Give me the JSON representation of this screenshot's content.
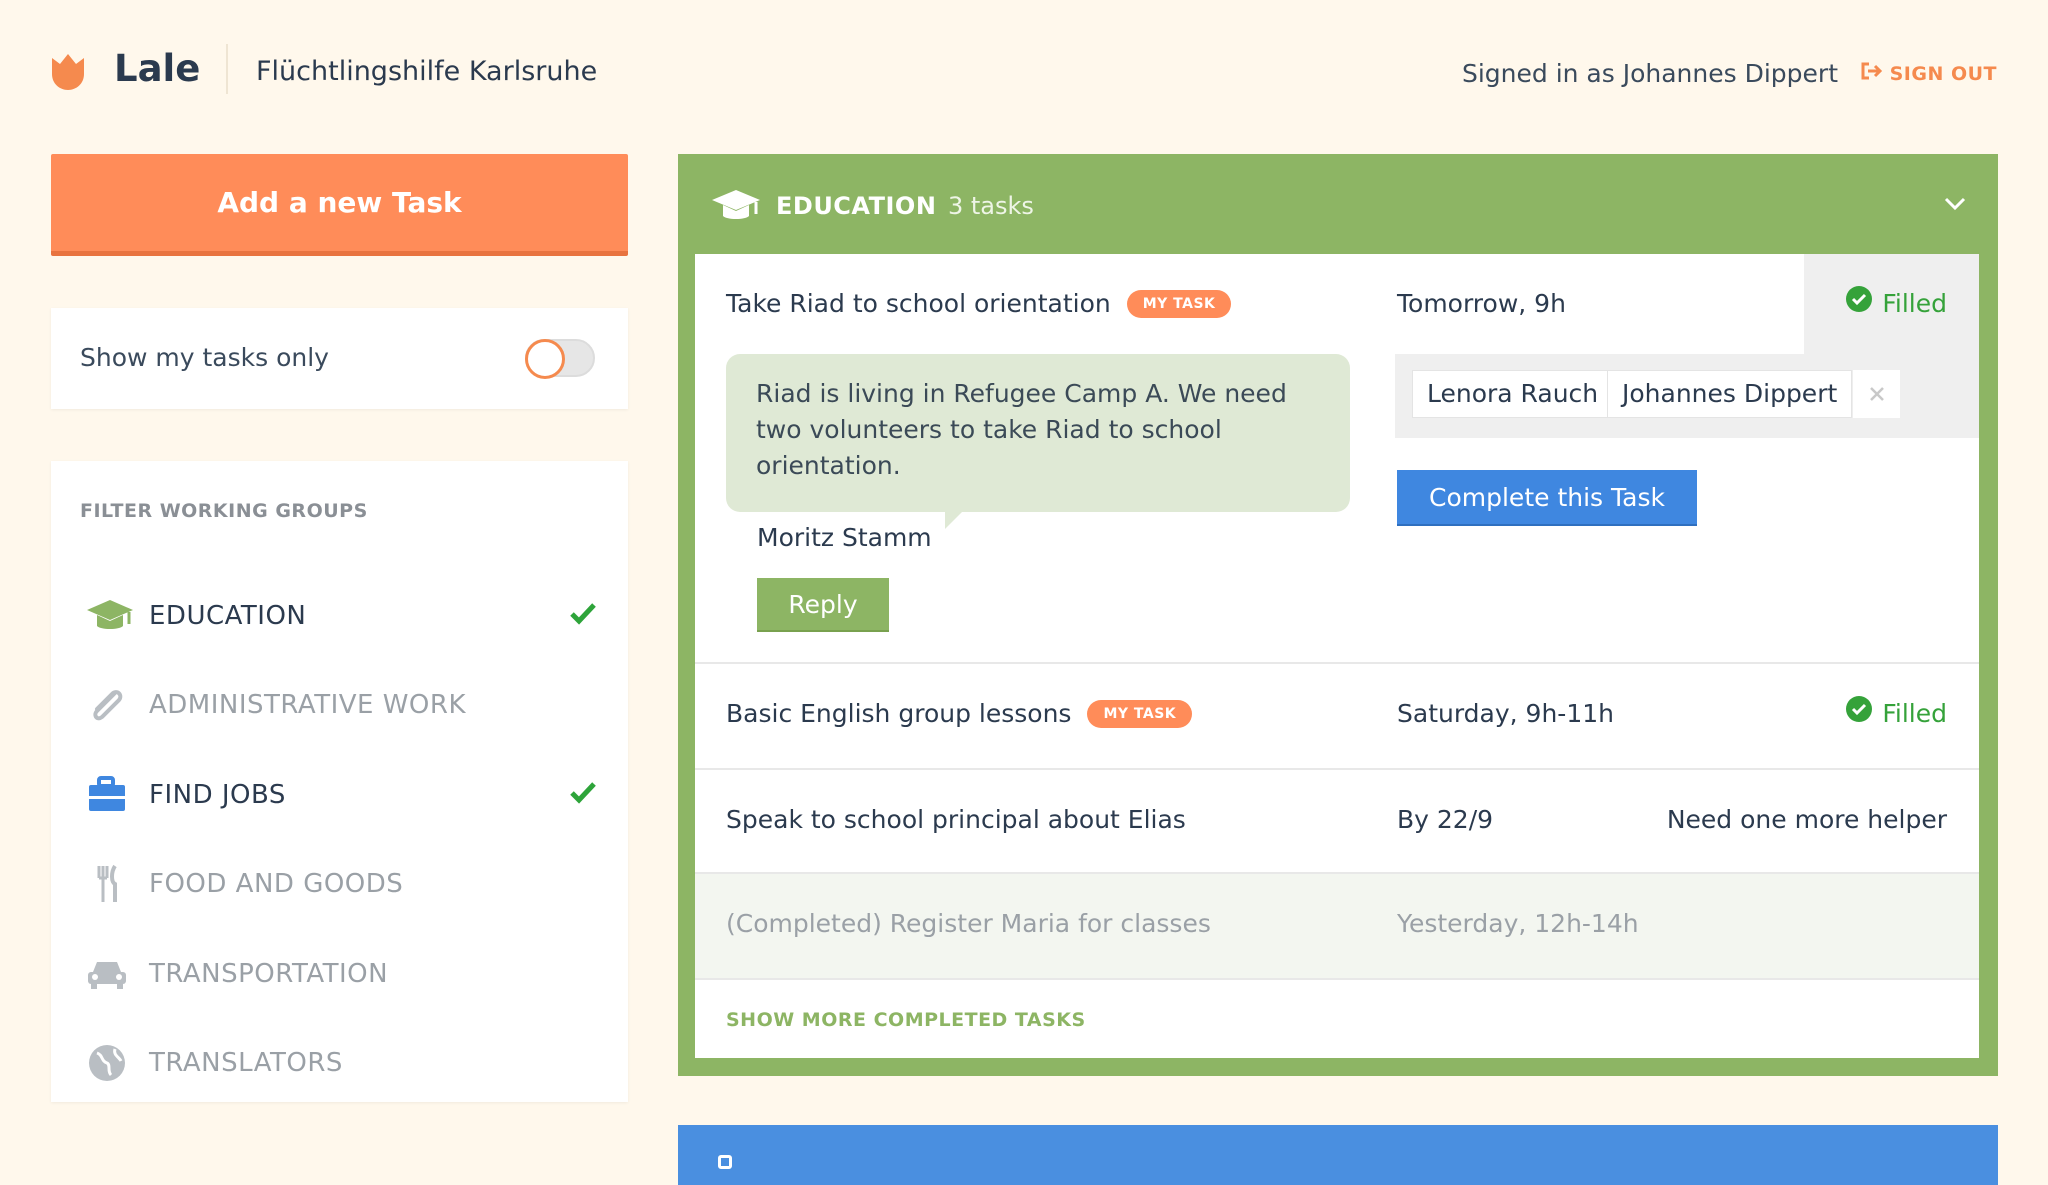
{
  "header": {
    "brand": "Lale",
    "organization": "Flüchtlingshilfe Karlsruhe",
    "signed_in": "Signed in as Johannes Dippert",
    "sign_out": "SIGN OUT"
  },
  "sidebar": {
    "add_task": "Add a new Task",
    "toggle_label": "Show my tasks only",
    "toggle_on": false,
    "filter_title": "FILTER WORKING GROUPS",
    "groups": [
      {
        "label": "EDUCATION",
        "icon": "graduation-cap-icon",
        "selected": true
      },
      {
        "label": "ADMINISTRATIVE WORK",
        "icon": "paperclip-icon",
        "selected": false
      },
      {
        "label": "FIND JOBS",
        "icon": "briefcase-icon",
        "selected": true
      },
      {
        "label": "FOOD AND GOODS",
        "icon": "fork-knife-icon",
        "selected": false
      },
      {
        "label": "TRANSPORTATION",
        "icon": "car-icon",
        "selected": false
      },
      {
        "label": "TRANSLATORS",
        "icon": "globe-icon",
        "selected": false
      }
    ]
  },
  "group": {
    "name": "EDUCATION",
    "count": "3 tasks",
    "color": "#8db564",
    "tasks": [
      {
        "title": "Take Riad to school orientation",
        "badge": "MY TASK",
        "when": "Tomorrow, 9h",
        "status": "Filled",
        "message": "Riad is living in Refugee Camp A. We need two volunteers to take Riad to school orientation.",
        "author": "Moritz Stamm",
        "reply": "Reply",
        "volunteers": [
          "Lenora Rauch",
          "Johannes Dippert"
        ],
        "complete": "Complete this Task"
      },
      {
        "title": "Basic English group lessons",
        "badge": "MY TASK",
        "when": "Saturday, 9h-11h",
        "status": "Filled"
      },
      {
        "title": "Speak to school principal about Elias",
        "when": "By 22/9",
        "status": "Need one more helper"
      }
    ],
    "completed": {
      "title": "(Completed) Register Maria for classes",
      "when": "Yesterday, 12h-14h"
    },
    "show_more": "SHOW MORE COMPLETED TASKS"
  },
  "colors": {
    "accent": "#ff8c59",
    "education": "#8db564",
    "jobs": "#3f87e0",
    "success": "#35a23a",
    "background": "#fff8ec"
  }
}
